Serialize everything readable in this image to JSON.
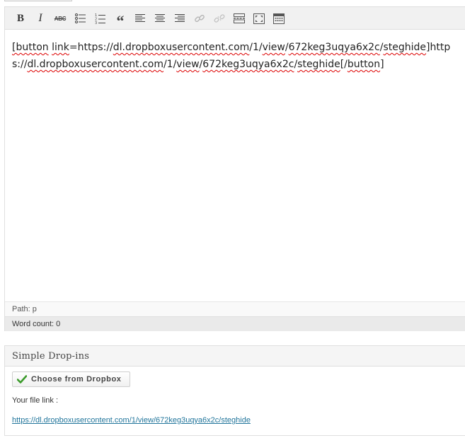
{
  "toolbar": {
    "bold_label": "B",
    "italic_label": "I",
    "strike_label": "ABC",
    "quote_label": "“",
    "icons": [
      "bold-icon",
      "italic-icon",
      "strikethrough-icon",
      "bullet-list-icon",
      "numbered-list-icon",
      "blockquote-icon",
      "align-left-icon",
      "align-center-icon",
      "align-right-icon",
      "insert-link-icon",
      "remove-link-icon",
      "insert-more-icon",
      "fullscreen-icon",
      "kitchen-sink-icon"
    ]
  },
  "editor": {
    "part1": "[button",
    "part2": "link",
    "part3": "=https://",
    "part4": "dl.dropboxusercontent.com",
    "part5": "/1/",
    "part6": "view",
    "part7": "/",
    "part8": "672keg3uqya6x2c",
    "part9": "/",
    "part10": "steghide",
    "part11": "]https://",
    "part12": "dl.dropboxusercontent.com",
    "part13": "/1/",
    "part14": "view",
    "part15": "/",
    "part16": "672keg3uqya6x2c",
    "part17": "/",
    "part18": "steghide",
    "part19": "[/",
    "part20": "button",
    "part21": "]"
  },
  "status": {
    "path": "Path: p",
    "word_count": "Word count: 0"
  },
  "dropins": {
    "title": "Simple Drop-ins",
    "button_label": "Choose from Dropbox",
    "file_link_label": "Your file link :",
    "file_link": "https://dl.dropboxusercontent.com/1/view/672keg3uqya6x2c/steghide"
  },
  "colors": {
    "link": "#21759b",
    "check": "#3a9a2a",
    "spellcheck": "#dd0000"
  }
}
